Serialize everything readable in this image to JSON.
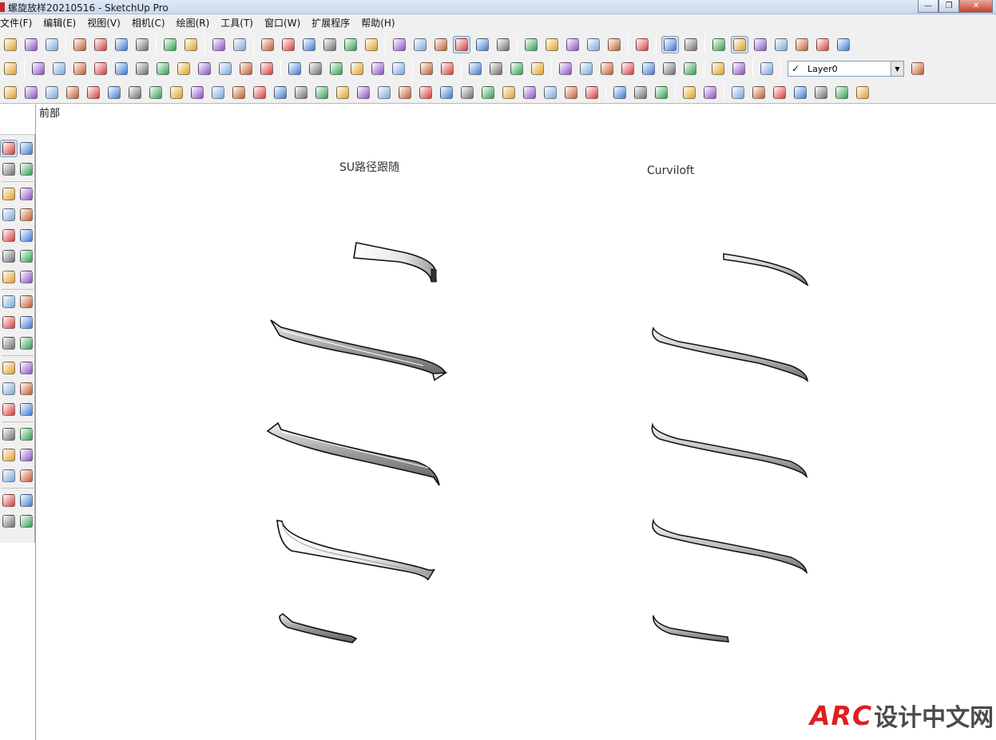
{
  "window": {
    "title": "螺旋放样20210516 - SketchUp Pro",
    "minimize_symbol": "—",
    "restore_symbol": "❐",
    "close_symbol": "✕"
  },
  "menu": [
    "文件(F)",
    "编辑(E)",
    "视图(V)",
    "相机(C)",
    "绘图(R)",
    "工具(T)",
    "窗口(W)",
    "扩展程序",
    "帮助(H)"
  ],
  "layer_control": {
    "checked_symbol": "✓",
    "current_layer": "Layer0"
  },
  "scene": {
    "tab_label": "前部"
  },
  "canvas": {
    "left_group_label": "SU路径跟随",
    "right_group_label": "Curviloft"
  },
  "watermark": {
    "brand": "ARC",
    "text": "设计中文网"
  },
  "toolbar_icons": {
    "row1": [
      "new-file-icon",
      "open-file-icon",
      "save-icon",
      "cut-icon",
      "copy-icon",
      "paste-icon",
      "erase-icon",
      "undo-icon",
      "redo-icon",
      "print-icon",
      "model-info-icon",
      "iso-view-icon",
      "top-view-icon",
      "front-view-icon",
      "right-view-icon",
      "back-view-icon",
      "left-view-icon",
      "xray-icon",
      "wireframe-icon",
      "hidden-line-icon",
      "shaded-icon",
      "shaded-texture-icon",
      "monochrome-icon",
      "section-plane-icon",
      "section-display-icon",
      "section-fill-icon",
      "section-cut-icon",
      "section-export-icon",
      "orbit-target-icon",
      "component-options-icon",
      "component-attributes-icon",
      "sandbox-from-contours-icon",
      "sandbox-scratch-icon",
      "sandbox-smoove-icon",
      "sandbox-stamp-icon",
      "sandbox-drape-icon",
      "sandbox-add-detail-icon",
      "sandbox-flip-edge-icon"
    ],
    "row2": [
      "style-icon",
      "face-style-icon",
      "back-edges-icon",
      "wire-style-icon",
      "hidden-style-icon",
      "shade-style-icon",
      "texture-style-icon",
      "mono-style-icon",
      "edge-style-icon",
      "profile-style-icon",
      "depth-cue-icon",
      "extension-style-icon",
      "grid-icon",
      "solid-union-icon",
      "solid-subtract-icon",
      "solid-trim-icon",
      "solid-intersect-icon",
      "outer-shell-icon",
      "split-icon",
      "dynamic-components-icon",
      "ds-plugin-icon",
      "photo-match-icon",
      "warehouse-icon",
      "share-model-icon",
      "extension-warehouse-icon",
      "send-to-layout-icon",
      "geo-location-icon",
      "toggle-terrain-icon",
      "add-location-icon",
      "preview-icon",
      "film-icon",
      "help-icon",
      "push-pull-icon",
      "paint-icon",
      "stairs-icon",
      "zorro-icon"
    ],
    "row3": [
      "rotate-rect-icon",
      "circle-center-icon",
      "arc-dots-icon",
      "soap-skin-icon",
      "layers-stack-icon",
      "join-push-icon",
      "edge-tools-icon",
      "weld-icon",
      "curviloft-icon",
      "bezier-icon",
      "extrude-edges-icon",
      "round-corner-icon",
      "fredo-scale-icon",
      "tools-on-surface-icon",
      "line-on-surface-icon",
      "polyline-icon",
      "offset-surface-icon",
      "spline-icon",
      "profile-builder-icon",
      "loft-icon",
      "joint-push-pull-icon",
      "vertex-tools-icon",
      "subdivide-icon",
      "quad-face-icon",
      "component-stringer-icon",
      "follow-me-icon",
      "tree-plugin-icon",
      "grass-plugin-icon",
      "skp-plugin-icon",
      "box-plugin-icon",
      "sphere-plugin-icon",
      "cube-plugin-icon",
      "paint-face-icon",
      "align-icon",
      "flip-up-icon",
      "flip-down-icon",
      "axis-icon",
      "mirror-icon",
      "undo-plugin-icon",
      "redo-plugin-icon",
      "hand-plugin-icon"
    ]
  },
  "palette_icons": [
    "select-arrow-icon",
    "component-icon",
    "paint-bucket-icon",
    "eraser-icon",
    "line-pencil-icon",
    "freehand-icon",
    "rectangle-icon",
    "rotated-rect-icon",
    "circle-icon",
    "polygon-icon",
    "arc-icon",
    "pie-icon",
    "arc-3pt-icon",
    "arc-2pt-icon",
    "move-icon",
    "push-pull-icon",
    "rotate-icon",
    "follow-me-icon",
    "scale-icon",
    "offset-icon",
    "tape-measure-icon",
    "dimension-icon",
    "protractor-icon",
    "text-icon",
    "axes-icon",
    "section-plane-icon",
    "orbit-icon",
    "pan-icon",
    "zoom-icon",
    "zoom-window-icon",
    "zoom-extents-icon",
    "previous-view-icon",
    "position-camera-icon",
    "look-around-icon",
    "walk-icon",
    "section-icon"
  ],
  "colors": {
    "accent_red": "#e01e1e",
    "selection_blue": "#7d9cc8"
  }
}
